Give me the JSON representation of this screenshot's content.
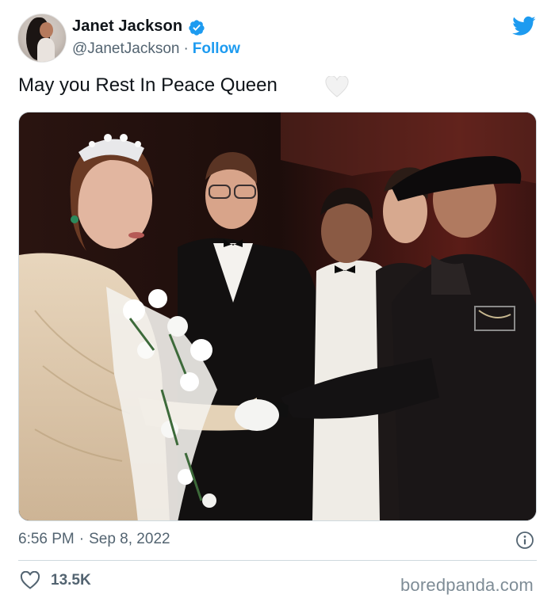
{
  "tweet": {
    "author_name": "Janet Jackson",
    "handle": "@JanetJackson",
    "separator": "·",
    "follow_label": "Follow",
    "text": "May you Rest In Peace Queen",
    "emoji": "white-heart-icon",
    "time": "6:56 PM",
    "date": "Sep 8, 2022",
    "like_count": "13.5K"
  },
  "icons": {
    "verified": "verified-badge-icon",
    "platform": "twitter-bird-icon",
    "info": "info-icon",
    "like": "heart-outline-icon"
  },
  "colors": {
    "accent": "#1d9bf0",
    "text": "#0f1419",
    "secondary": "#536471",
    "divider": "#cfd9de"
  },
  "watermark": "boredpanda.com"
}
